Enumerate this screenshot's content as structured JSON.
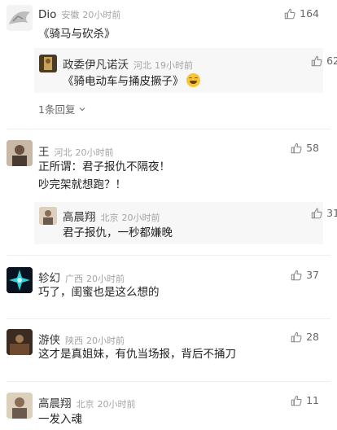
{
  "comments": [
    {
      "name": "Dio",
      "location": "安徽",
      "time": "20小时前",
      "likes": "164",
      "text": [
        "《骑马与砍杀》"
      ],
      "reply": {
        "name": "政委伊凡诺沃",
        "location": "河北",
        "time": "19小时前",
        "likes": "62",
        "text": "《骑电动车与捅皮撅子》",
        "emoji": "laughing-tears-emoji"
      },
      "more_replies": "1条回复"
    },
    {
      "name": "王",
      "location": "河北",
      "time": "20小时前",
      "likes": "58",
      "text": [
        "正所谓：君子报仇不隔夜！",
        "吵完架就想跑？！"
      ],
      "reply": {
        "name": "高晨翔",
        "location": "北京",
        "time": "20小时前",
        "likes": "31",
        "text": "君子报仇，一秒都嫌晚"
      }
    },
    {
      "name": "轸幻",
      "location": "广西",
      "time": "20小时前",
      "likes": "37",
      "text": [
        "巧了，闺蜜也是这么想的"
      ]
    },
    {
      "name": "游侠",
      "location": "陕西",
      "time": "20小时前",
      "likes": "28",
      "text": [
        "这才是真姐妹，有仇当场报，背后不捅刀"
      ]
    },
    {
      "name": "高晨翔",
      "location": "北京",
      "time": "20小时前",
      "likes": "11",
      "text": [
        "一发入魂"
      ]
    }
  ],
  "colors": {
    "meta": "#a3a3a3",
    "reply_bg": "#f7f7f7",
    "like_icon": "#888888"
  },
  "icons": {
    "like": "thumbs-up-icon",
    "chevron": "chevron-down-icon"
  }
}
